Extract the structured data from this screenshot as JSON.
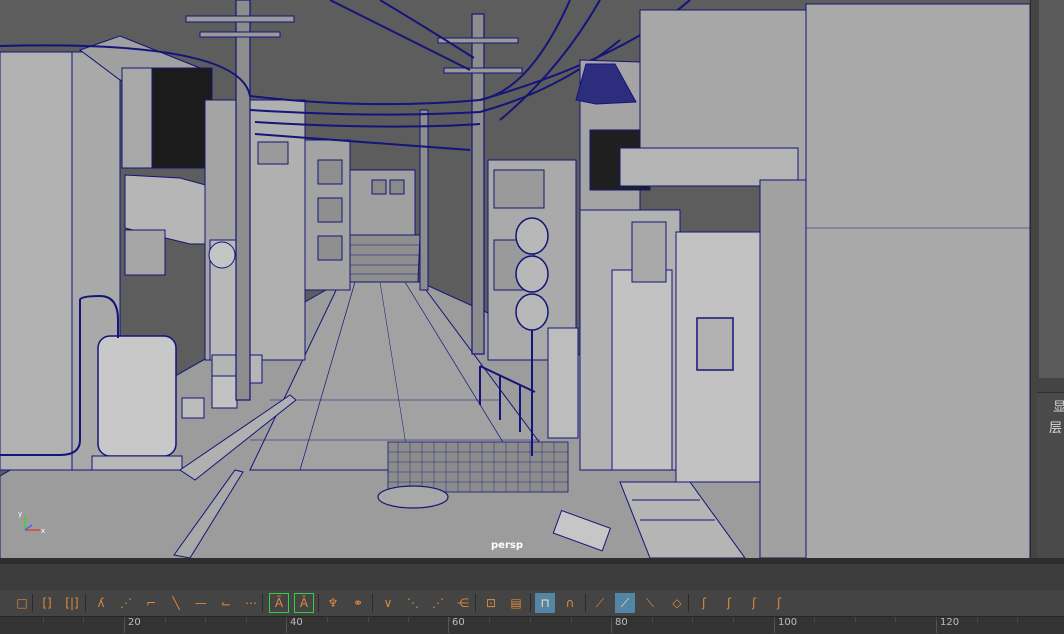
{
  "viewport": {
    "camera_label": "persp",
    "axis_x": "x",
    "axis_y": "y"
  },
  "right_panel": {
    "char_top": "显",
    "char_bottom": "层"
  },
  "toolbar": {
    "buttons": [
      {
        "icon": "square-select-icon",
        "glyph": "□"
      },
      {
        "icon": "bracket-select-icon",
        "glyph": "[]"
      },
      {
        "icon": "split-select-icon",
        "glyph": "[|]"
      },
      {
        "icon": "joint-tool-icon",
        "glyph": "ʎ"
      },
      {
        "icon": "curve-point-icon",
        "glyph": "⋰"
      },
      {
        "icon": "curve-step-icon",
        "glyph": "⌐"
      },
      {
        "icon": "line-tool-icon",
        "glyph": "╲"
      },
      {
        "icon": "flat-tangent-icon",
        "glyph": "—"
      },
      {
        "icon": "step-tangent-icon",
        "glyph": "⌙"
      },
      {
        "icon": "spline-tangent-icon",
        "glyph": "⋯"
      },
      {
        "icon": "key-in-icon",
        "glyph": "Ā"
      },
      {
        "icon": "key-out-icon",
        "glyph": "Ā"
      },
      {
        "icon": "figure-pose-icon",
        "glyph": "♆"
      },
      {
        "icon": "figure-mirror-icon",
        "glyph": "⚭"
      },
      {
        "icon": "vertex-v-icon",
        "glyph": "∨"
      },
      {
        "icon": "vertex-diag-icon",
        "glyph": "⋱"
      },
      {
        "icon": "vertex-zig-icon",
        "glyph": "⋰"
      },
      {
        "icon": "vertex-lock-icon",
        "glyph": "⋲"
      },
      {
        "icon": "graph-editor-icon",
        "glyph": "⊡"
      },
      {
        "icon": "table-icon",
        "glyph": "▤"
      },
      {
        "icon": "ruler-icon",
        "glyph": "⊓"
      },
      {
        "icon": "magnet-icon",
        "glyph": "∩"
      },
      {
        "icon": "buffer-curve-icon",
        "glyph": "⟋"
      },
      {
        "icon": "buffer-swap-icon",
        "glyph": "⟋"
      },
      {
        "icon": "normalize-icon",
        "glyph": "⟍"
      },
      {
        "icon": "snap-icon",
        "glyph": "◇"
      },
      {
        "icon": "cycle-pre-icon",
        "glyph": "ʃ"
      },
      {
        "icon": "cycle-post-icon",
        "glyph": "ʃ"
      },
      {
        "icon": "cycle-both-icon",
        "glyph": "ʃ"
      },
      {
        "icon": "cycle-offset-icon",
        "glyph": "ʃ"
      }
    ]
  },
  "timeline": {
    "ticks": [
      "20",
      "40",
      "60",
      "80",
      "100",
      "120"
    ]
  },
  "colors": {
    "wire": "#14147a",
    "viewport_bg": "#5d5d5d",
    "surface": "#a6a6a6",
    "accent_active": "#5285a6",
    "frame_green": "#30d040"
  }
}
